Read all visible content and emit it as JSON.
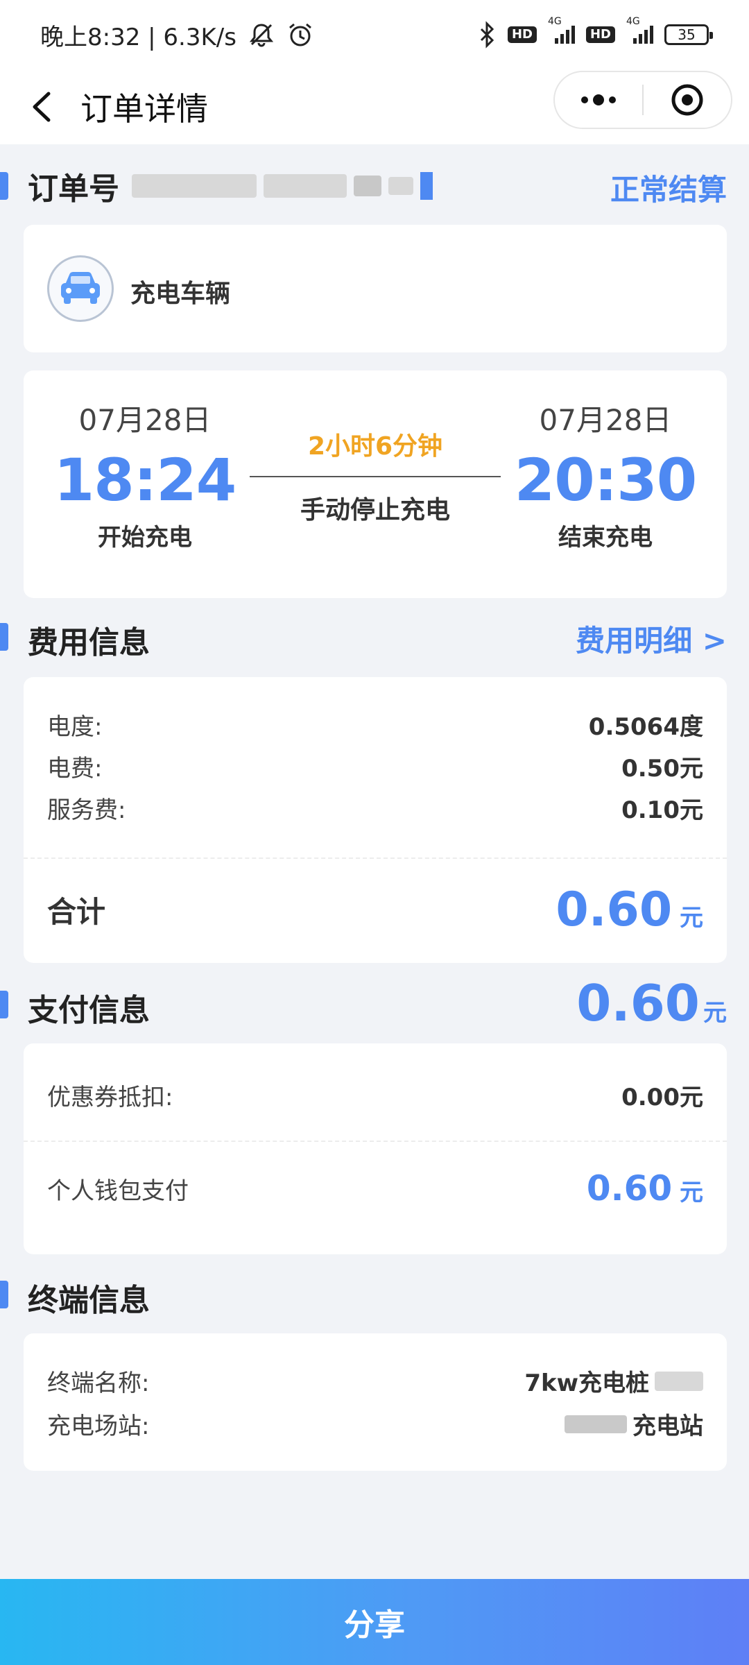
{
  "status_bar": {
    "time": "晚上8:32 | 6.3K/s",
    "network_badge_1": "HD",
    "network_badge_2": "HD",
    "network_tech_1": "4G",
    "network_tech_2": "4G",
    "battery": "35"
  },
  "nav": {
    "title": "订单详情"
  },
  "order": {
    "label": "订单号",
    "status": "正常结算"
  },
  "vehicle": {
    "label": "充电车辆"
  },
  "charge": {
    "start_date": "07月28日",
    "start_time": "18:24",
    "start_label": "开始充电",
    "duration": "2小时6分钟",
    "stop_reason": "手动停止充电",
    "end_date": "07月28日",
    "end_time": "20:30",
    "end_label": "结束充电"
  },
  "fee": {
    "title": "费用信息",
    "detail_link": "费用明细 >",
    "rows": [
      {
        "label": "电度:",
        "value": "0.5064度"
      },
      {
        "label": "电费:",
        "value": "0.50元"
      },
      {
        "label": "服务费:",
        "value": "0.10元"
      }
    ],
    "total_label": "合计",
    "total_amount": "0.60",
    "total_unit": "元"
  },
  "payment": {
    "title": "支付信息",
    "amount": "0.60",
    "unit": "元",
    "coupon_label": "优惠券抵扣:",
    "coupon_value": "0.00元",
    "wallet_label": "个人钱包支付",
    "wallet_amount": "0.60",
    "wallet_unit": "元"
  },
  "terminal": {
    "title": "终端信息",
    "name_label": "终端名称:",
    "name_value": "7kw充电桩",
    "station_label": "充电场站:",
    "station_value": "充电站"
  },
  "share": {
    "label": "分享"
  },
  "colors": {
    "accent": "#4e89f2",
    "duration": "#f0a422",
    "background": "#f1f3f7"
  }
}
